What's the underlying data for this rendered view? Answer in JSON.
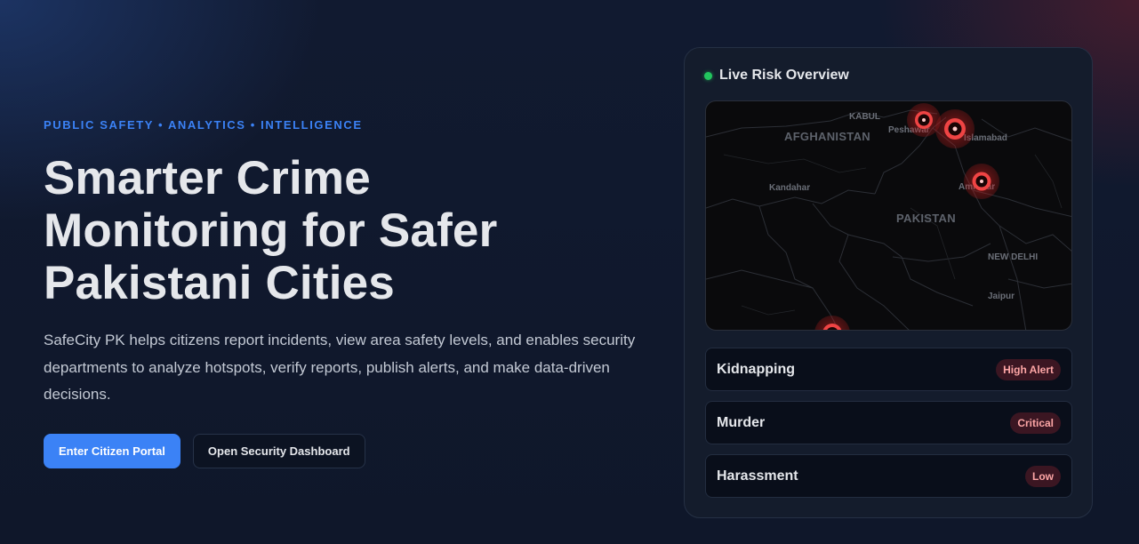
{
  "hero": {
    "eyebrow": "PUBLIC SAFETY • ANALYTICS • INTELLIGENCE",
    "headline": "Smarter Crime Monitoring for Safer Pakistani Cities",
    "lead": "SafeCity PK helps citizens report incidents, view area safety levels, and enables security departments to analyze hotspots, verify reports, publish alerts, and make data-driven decisions.",
    "primary_button": "Enter Citizen Portal",
    "secondary_button": "Open Security Dashboard"
  },
  "card": {
    "title": "Live Risk Overview",
    "live_color": "#22c55e",
    "map": {
      "countries": {
        "afghanistan": "AFGHANISTAN",
        "pakistan": "PAKISTAN"
      },
      "cities": {
        "kabul": "KABUL",
        "peshawar": "Peshawar",
        "islamabad": "Islamabad",
        "kandahar": "Kandahar",
        "amritsar": "Amritsar",
        "new_delhi": "NEW DELHI",
        "jaipur": "Jaipur"
      }
    },
    "risks": [
      {
        "name": "Kidnapping",
        "level": "High Alert"
      },
      {
        "name": "Murder",
        "level": "Critical"
      },
      {
        "name": "Harassment",
        "level": "Low"
      }
    ]
  },
  "colors": {
    "accent": "#3b82f6",
    "alert": "#ef4444",
    "badge_text": "#fca5a5",
    "badge_bg": "#3b1622"
  }
}
